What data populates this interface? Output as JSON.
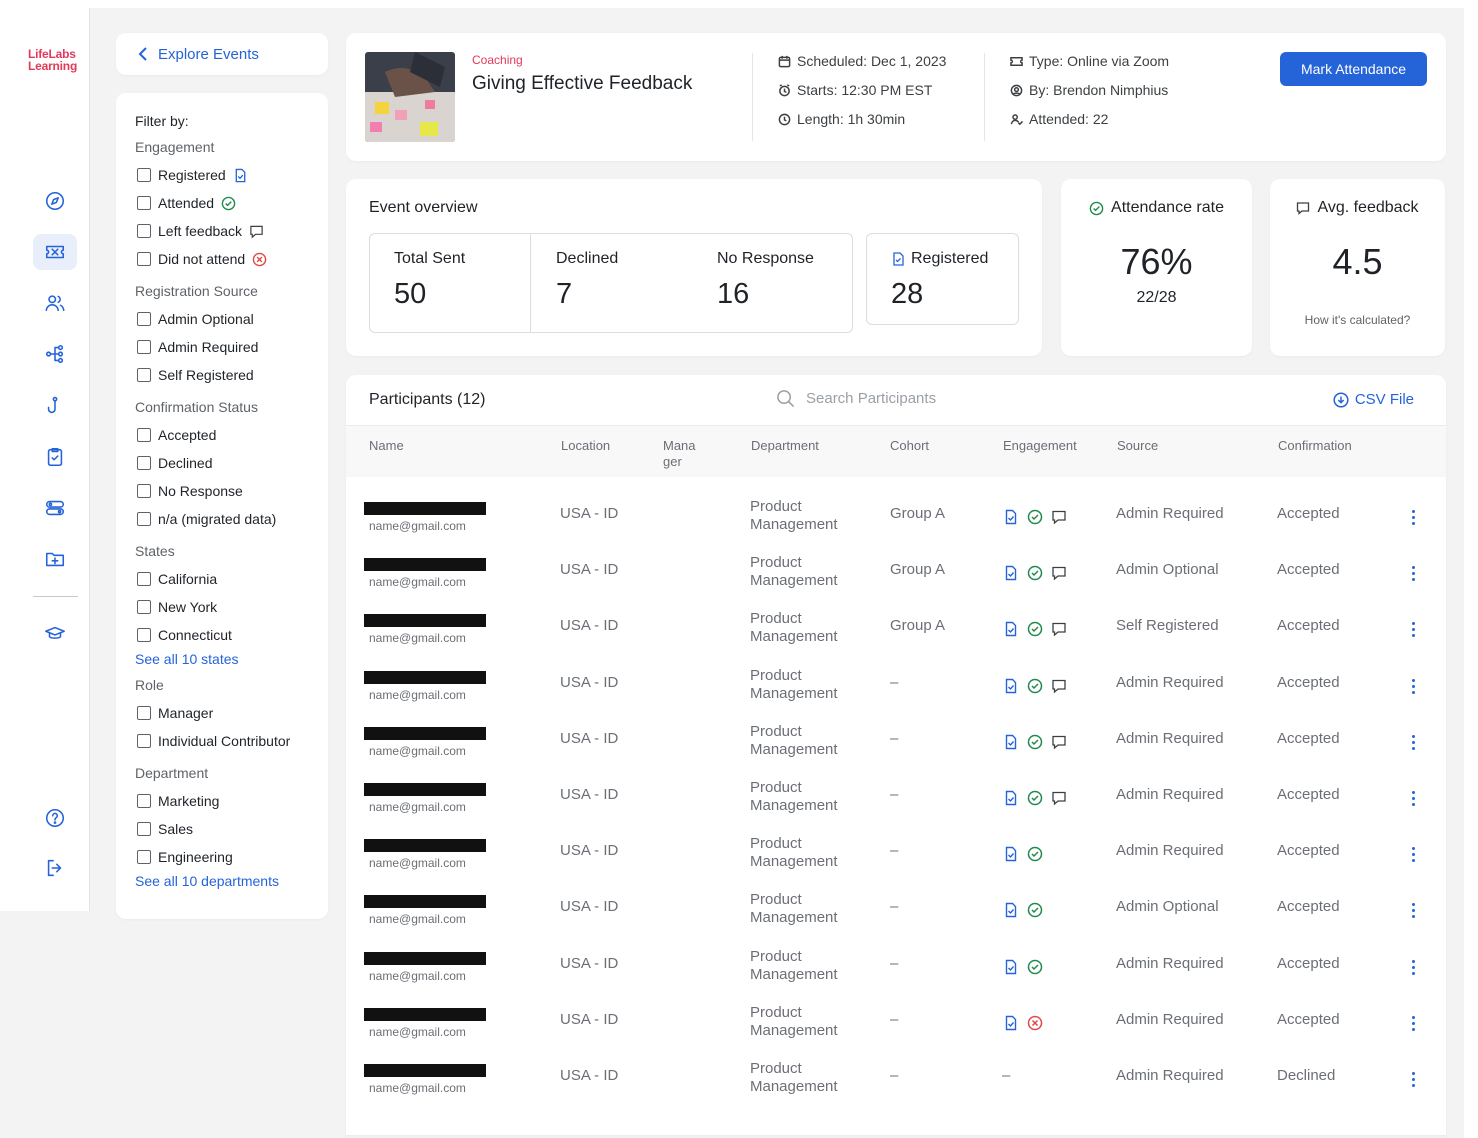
{
  "brand": {
    "line1": "LifeLabs",
    "line2": "Learning"
  },
  "nav": {
    "back_label": "Explore Events"
  },
  "filters": {
    "title": "Filter by:",
    "groups": [
      {
        "label": "Engagement",
        "items": [
          "Registered",
          "Attended",
          "Left feedback",
          "Did not attend"
        ]
      },
      {
        "label": "Registration Source",
        "items": [
          "Admin Optional",
          "Admin Required",
          "Self Registered"
        ]
      },
      {
        "label": "Confirmation Status",
        "items": [
          "Accepted",
          "Declined",
          "No Response",
          "n/a (migrated data)"
        ]
      },
      {
        "label": "States",
        "items": [
          "California",
          "New York",
          "Connecticut"
        ],
        "link": "See all 10 states"
      },
      {
        "label": "Role",
        "items": [
          "Manager",
          "Individual Contributor"
        ]
      },
      {
        "label": "Department",
        "items": [
          "Marketing",
          "Sales",
          "Engineering"
        ],
        "link": "See all 10 departments"
      }
    ]
  },
  "event": {
    "category": "Coaching",
    "title": "Giving Effective Feedback",
    "scheduled": "Scheduled: Dec 1, 2023",
    "starts": "Starts: 12:30 PM EST",
    "length": "Length: 1h 30min",
    "type": "Type: Online via Zoom",
    "by": "By: Brendon Nimphius",
    "attended": "Attended: 22",
    "action_label": "Mark Attendance"
  },
  "overview": {
    "title": "Event overview",
    "total_sent": {
      "label": "Total Sent",
      "value": "50"
    },
    "declined": {
      "label": "Declined",
      "value": "7"
    },
    "no_response": {
      "label": "No Response",
      "value": "16"
    },
    "registered": {
      "label": "Registered",
      "value": "28"
    }
  },
  "attendance": {
    "title": "Attendance rate",
    "value": "76%",
    "sub": "22/28"
  },
  "feedback": {
    "title": "Avg. feedback",
    "value": "4.5",
    "note": "How it's calculated?"
  },
  "participants": {
    "title": "Participants (12)",
    "search_placeholder": "Search Participants",
    "csv_label": "CSV File",
    "columns": [
      "Name",
      "Location",
      "Mana ger",
      "Department",
      "Cohort",
      "Engagement",
      "Source",
      "Confirmation"
    ],
    "rows": [
      {
        "email": "name@gmail.com",
        "location": "USA - ID",
        "dept1": "Product",
        "dept2": "Management",
        "cohort": "Group A",
        "eng": [
          "reg",
          "att",
          "fb"
        ],
        "source": "Admin Required",
        "confirmation": "Accepted"
      },
      {
        "email": "name@gmail.com",
        "location": "USA - ID",
        "dept1": "Product",
        "dept2": "Management",
        "cohort": "Group A",
        "eng": [
          "reg",
          "att",
          "fb"
        ],
        "source": "Admin Optional",
        "confirmation": "Accepted"
      },
      {
        "email": "name@gmail.com",
        "location": "USA - ID",
        "dept1": "Product",
        "dept2": "Management",
        "cohort": "Group A",
        "eng": [
          "reg",
          "att",
          "fb"
        ],
        "source": "Self Registered",
        "confirmation": "Accepted"
      },
      {
        "email": "name@gmail.com",
        "location": "USA - ID",
        "dept1": "Product",
        "dept2": "Management",
        "cohort": "–",
        "eng": [
          "reg",
          "att",
          "fb"
        ],
        "source": "Admin Required",
        "confirmation": "Accepted"
      },
      {
        "email": "name@gmail.com",
        "location": "USA - ID",
        "dept1": "Product",
        "dept2": "Management",
        "cohort": "–",
        "eng": [
          "reg",
          "att",
          "fb"
        ],
        "source": "Admin Required",
        "confirmation": "Accepted"
      },
      {
        "email": "name@gmail.com",
        "location": "USA - ID",
        "dept1": "Product",
        "dept2": "Management",
        "cohort": "–",
        "eng": [
          "reg",
          "att",
          "fb"
        ],
        "source": "Admin Required",
        "confirmation": "Accepted"
      },
      {
        "email": "name@gmail.com",
        "location": "USA - ID",
        "dept1": "Product",
        "dept2": "Management",
        "cohort": "–",
        "eng": [
          "reg",
          "att"
        ],
        "source": "Admin Required",
        "confirmation": "Accepted"
      },
      {
        "email": "name@gmail.com",
        "location": "USA - ID",
        "dept1": "Product",
        "dept2": "Management",
        "cohort": "–",
        "eng": [
          "reg",
          "att"
        ],
        "source": "Admin Optional",
        "confirmation": "Accepted"
      },
      {
        "email": "name@gmail.com",
        "location": "USA - ID",
        "dept1": "Product",
        "dept2": "Management",
        "cohort": "–",
        "eng": [
          "reg",
          "att"
        ],
        "source": "Admin Required",
        "confirmation": "Accepted"
      },
      {
        "email": "name@gmail.com",
        "location": "USA - ID",
        "dept1": "Product",
        "dept2": "Management",
        "cohort": "–",
        "eng": [
          "reg",
          "dna"
        ],
        "source": "Admin Required",
        "confirmation": "Accepted"
      },
      {
        "email": "name@gmail.com",
        "location": "USA - ID",
        "dept1": "Product",
        "dept2": "Management",
        "cohort": "–",
        "eng_text": "–",
        "eng": [],
        "source": "Admin Required",
        "confirmation": "Declined"
      }
    ]
  },
  "colors": {
    "accent": "#2563d9",
    "brand": "#e33a5a",
    "success": "#1f8a4c",
    "danger": "#e04848"
  }
}
